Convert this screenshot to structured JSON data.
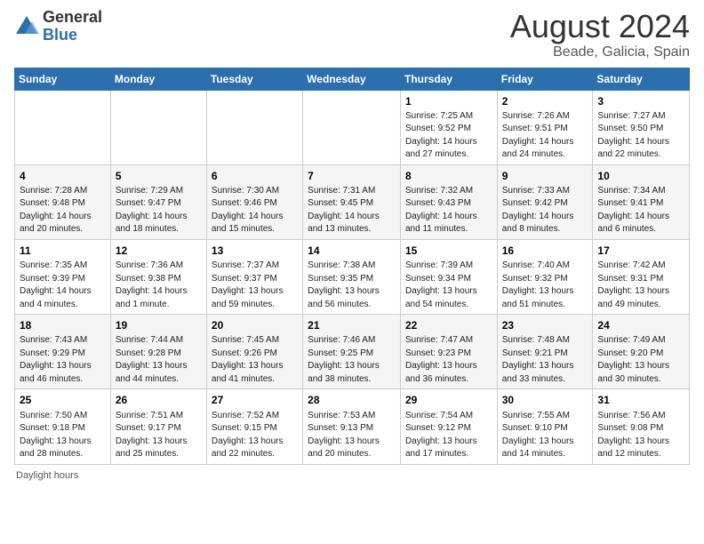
{
  "logo": {
    "general": "General",
    "blue": "Blue"
  },
  "title": {
    "month_year": "August 2024",
    "location": "Beade, Galicia, Spain"
  },
  "days_of_week": [
    "Sunday",
    "Monday",
    "Tuesday",
    "Wednesday",
    "Thursday",
    "Friday",
    "Saturday"
  ],
  "weeks": [
    [
      {
        "day": "",
        "info": ""
      },
      {
        "day": "",
        "info": ""
      },
      {
        "day": "",
        "info": ""
      },
      {
        "day": "",
        "info": ""
      },
      {
        "day": "1",
        "info": "Sunrise: 7:25 AM\nSunset: 9:52 PM\nDaylight: 14 hours and 27 minutes."
      },
      {
        "day": "2",
        "info": "Sunrise: 7:26 AM\nSunset: 9:51 PM\nDaylight: 14 hours and 24 minutes."
      },
      {
        "day": "3",
        "info": "Sunrise: 7:27 AM\nSunset: 9:50 PM\nDaylight: 14 hours and 22 minutes."
      }
    ],
    [
      {
        "day": "4",
        "info": "Sunrise: 7:28 AM\nSunset: 9:48 PM\nDaylight: 14 hours and 20 minutes."
      },
      {
        "day": "5",
        "info": "Sunrise: 7:29 AM\nSunset: 9:47 PM\nDaylight: 14 hours and 18 minutes."
      },
      {
        "day": "6",
        "info": "Sunrise: 7:30 AM\nSunset: 9:46 PM\nDaylight: 14 hours and 15 minutes."
      },
      {
        "day": "7",
        "info": "Sunrise: 7:31 AM\nSunset: 9:45 PM\nDaylight: 14 hours and 13 minutes."
      },
      {
        "day": "8",
        "info": "Sunrise: 7:32 AM\nSunset: 9:43 PM\nDaylight: 14 hours and 11 minutes."
      },
      {
        "day": "9",
        "info": "Sunrise: 7:33 AM\nSunset: 9:42 PM\nDaylight: 14 hours and 8 minutes."
      },
      {
        "day": "10",
        "info": "Sunrise: 7:34 AM\nSunset: 9:41 PM\nDaylight: 14 hours and 6 minutes."
      }
    ],
    [
      {
        "day": "11",
        "info": "Sunrise: 7:35 AM\nSunset: 9:39 PM\nDaylight: 14 hours and 4 minutes."
      },
      {
        "day": "12",
        "info": "Sunrise: 7:36 AM\nSunset: 9:38 PM\nDaylight: 14 hours and 1 minute."
      },
      {
        "day": "13",
        "info": "Sunrise: 7:37 AM\nSunset: 9:37 PM\nDaylight: 13 hours and 59 minutes."
      },
      {
        "day": "14",
        "info": "Sunrise: 7:38 AM\nSunset: 9:35 PM\nDaylight: 13 hours and 56 minutes."
      },
      {
        "day": "15",
        "info": "Sunrise: 7:39 AM\nSunset: 9:34 PM\nDaylight: 13 hours and 54 minutes."
      },
      {
        "day": "16",
        "info": "Sunrise: 7:40 AM\nSunset: 9:32 PM\nDaylight: 13 hours and 51 minutes."
      },
      {
        "day": "17",
        "info": "Sunrise: 7:42 AM\nSunset: 9:31 PM\nDaylight: 13 hours and 49 minutes."
      }
    ],
    [
      {
        "day": "18",
        "info": "Sunrise: 7:43 AM\nSunset: 9:29 PM\nDaylight: 13 hours and 46 minutes."
      },
      {
        "day": "19",
        "info": "Sunrise: 7:44 AM\nSunset: 9:28 PM\nDaylight: 13 hours and 44 minutes."
      },
      {
        "day": "20",
        "info": "Sunrise: 7:45 AM\nSunset: 9:26 PM\nDaylight: 13 hours and 41 minutes."
      },
      {
        "day": "21",
        "info": "Sunrise: 7:46 AM\nSunset: 9:25 PM\nDaylight: 13 hours and 38 minutes."
      },
      {
        "day": "22",
        "info": "Sunrise: 7:47 AM\nSunset: 9:23 PM\nDaylight: 13 hours and 36 minutes."
      },
      {
        "day": "23",
        "info": "Sunrise: 7:48 AM\nSunset: 9:21 PM\nDaylight: 13 hours and 33 minutes."
      },
      {
        "day": "24",
        "info": "Sunrise: 7:49 AM\nSunset: 9:20 PM\nDaylight: 13 hours and 30 minutes."
      }
    ],
    [
      {
        "day": "25",
        "info": "Sunrise: 7:50 AM\nSunset: 9:18 PM\nDaylight: 13 hours and 28 minutes."
      },
      {
        "day": "26",
        "info": "Sunrise: 7:51 AM\nSunset: 9:17 PM\nDaylight: 13 hours and 25 minutes."
      },
      {
        "day": "27",
        "info": "Sunrise: 7:52 AM\nSunset: 9:15 PM\nDaylight: 13 hours and 22 minutes."
      },
      {
        "day": "28",
        "info": "Sunrise: 7:53 AM\nSunset: 9:13 PM\nDaylight: 13 hours and 20 minutes."
      },
      {
        "day": "29",
        "info": "Sunrise: 7:54 AM\nSunset: 9:12 PM\nDaylight: 13 hours and 17 minutes."
      },
      {
        "day": "30",
        "info": "Sunrise: 7:55 AM\nSunset: 9:10 PM\nDaylight: 13 hours and 14 minutes."
      },
      {
        "day": "31",
        "info": "Sunrise: 7:56 AM\nSunset: 9:08 PM\nDaylight: 13 hours and 12 minutes."
      }
    ]
  ],
  "footer": {
    "daylight_label": "Daylight hours"
  }
}
